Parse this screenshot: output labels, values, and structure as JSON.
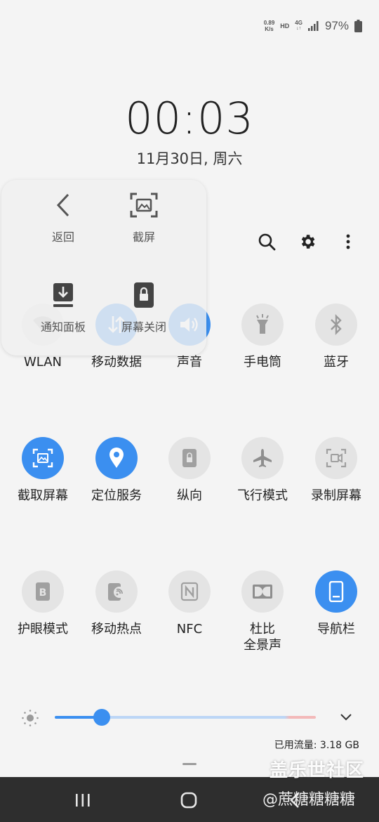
{
  "status_bar": {
    "speed_value": "0.89",
    "speed_unit": "K/s",
    "hd": "HD",
    "network": "4G",
    "battery": "97%"
  },
  "clock": {
    "time": "00:03",
    "date": "11月30日, 周六"
  },
  "top_actions": [
    "search-icon",
    "gear-icon",
    "more-vert-icon"
  ],
  "tiles": [
    {
      "label": "WLAN",
      "icon": "wifi-icon",
      "on": false
    },
    {
      "label": "移动数据",
      "icon": "mobile-data-icon",
      "on": true
    },
    {
      "label": "声音",
      "icon": "sound-icon",
      "on": true
    },
    {
      "label": "手电筒",
      "icon": "flashlight-icon",
      "on": false
    },
    {
      "label": "蓝牙",
      "icon": "bluetooth-icon",
      "on": false
    },
    {
      "label": "截取屏幕",
      "icon": "screen-capture-icon",
      "on": true
    },
    {
      "label": "定位服务",
      "icon": "location-icon",
      "on": true
    },
    {
      "label": "纵向",
      "icon": "portrait-lock-icon",
      "on": false
    },
    {
      "label": "飞行模式",
      "icon": "airplane-icon",
      "on": false
    },
    {
      "label": "录制屏幕",
      "icon": "screen-record-icon",
      "on": false
    },
    {
      "label": "护眼模式",
      "icon": "eye-comfort-icon",
      "on": false
    },
    {
      "label": "移动热点",
      "icon": "hotspot-icon",
      "on": false
    },
    {
      "label": "NFC",
      "icon": "nfc-icon",
      "on": false
    },
    {
      "label": "杜比\n全景声",
      "icon": "dolby-icon",
      "on": false
    },
    {
      "label": "导航栏",
      "icon": "navigation-bar-icon",
      "on": true
    }
  ],
  "brightness": {
    "level": 0.18
  },
  "data_usage": "已用流量: 3.18 GB",
  "assistant_menu": {
    "back": "返回",
    "screenshot": "截屏",
    "notification_panel": "通知面板",
    "screen_off": "屏幕关闭"
  },
  "colors": {
    "accent": "#3b8ff0",
    "tile_off": "#e4e4e4",
    "navbar": "#2e2e2e"
  },
  "watermark": {
    "line1": "盖乐世社区",
    "line2": "@蔗糖糖糖糖"
  }
}
